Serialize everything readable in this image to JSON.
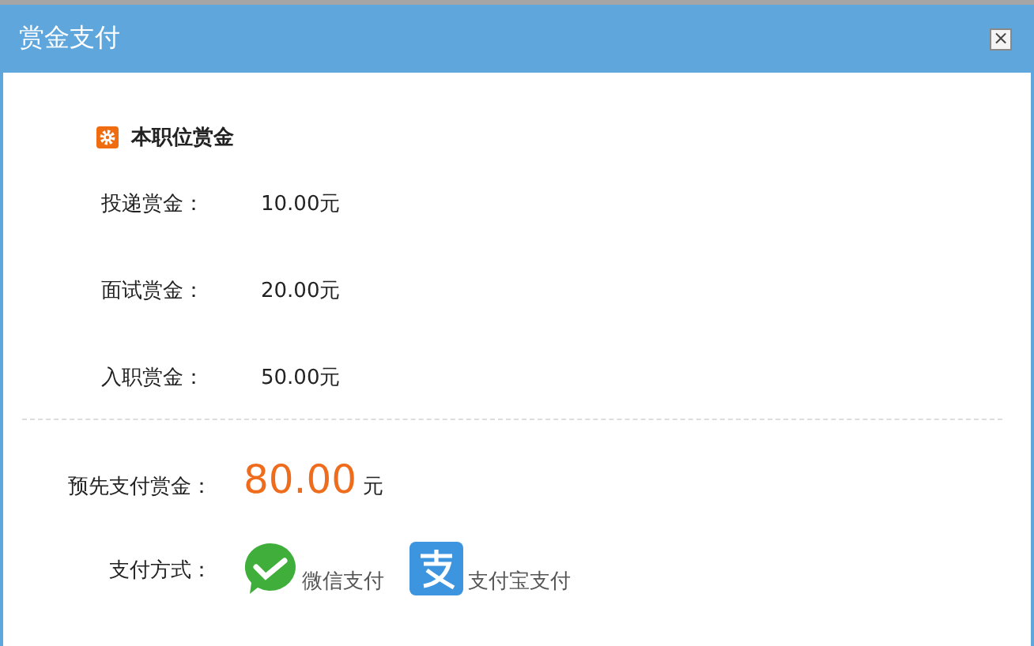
{
  "window": {
    "title": "赏金支付",
    "close": "×"
  },
  "section": {
    "title": "本职位赏金"
  },
  "rewards": [
    {
      "label": "投递赏金：",
      "value": "10.00元"
    },
    {
      "label": "面试赏金：",
      "value": "20.00元"
    },
    {
      "label": "入职赏金：",
      "value": "50.00元"
    }
  ],
  "total": {
    "label": "预先支付赏金：",
    "amount": "80.00",
    "unit": "元"
  },
  "payment": {
    "label": "支付方式：",
    "methods": [
      {
        "kind": "wechat",
        "label": "微信支付"
      },
      {
        "kind": "alipay",
        "label": "支付宝支付"
      }
    ]
  }
}
